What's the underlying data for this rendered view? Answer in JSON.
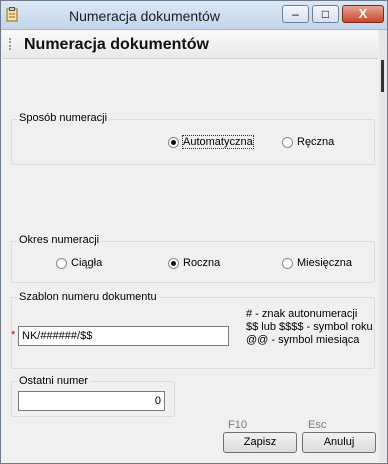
{
  "window": {
    "title": "Numeracja dokumentów",
    "controls": {
      "minimize": "–",
      "maximize": "□",
      "close": "X"
    }
  },
  "header": {
    "title": "Numeracja dokumentów"
  },
  "numbering_method": {
    "label": "Sposób numeracji",
    "options": [
      {
        "label": "Automatyczna",
        "selected": true
      },
      {
        "label": "Ręczna",
        "selected": false
      }
    ]
  },
  "numbering_period": {
    "label": "Okres numeracji",
    "options": [
      {
        "label": "Ciągła",
        "selected": false
      },
      {
        "label": "Roczna",
        "selected": true
      },
      {
        "label": "Miesięczna",
        "selected": false
      }
    ]
  },
  "template": {
    "label": "Szablon numeru dokumentu",
    "required_marker": "*",
    "value": "NK/######/$$",
    "hints": [
      "# - znak autonumeracji",
      "$$ lub $$$$ - symbol roku",
      "@@ - symbol miesiąca"
    ]
  },
  "last_number": {
    "label": "Ostatni numer",
    "value": "0"
  },
  "actions": {
    "save": {
      "key": "F10",
      "label": "Zapisz"
    },
    "cancel": {
      "key": "Esc",
      "label": "Anuluj"
    }
  }
}
